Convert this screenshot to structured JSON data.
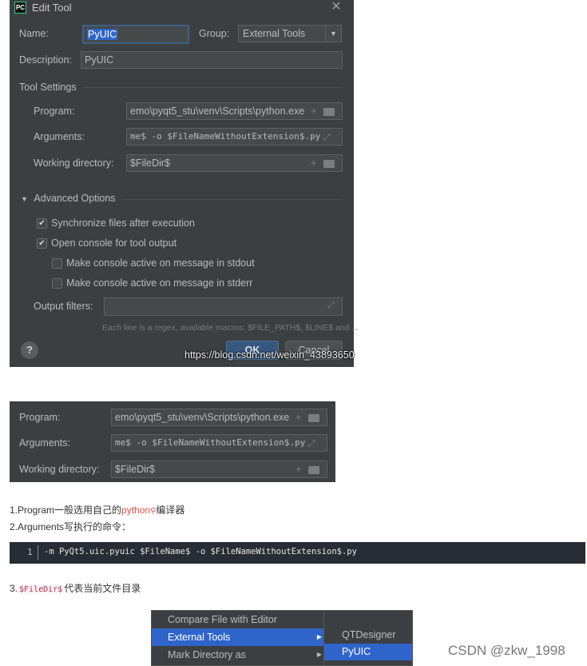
{
  "dialog": {
    "title": "Edit Tool",
    "name_label": "Name:",
    "name_value": "PyUIC",
    "group_label": "Group:",
    "group_value": "External Tools",
    "description_label": "Description:",
    "description_value": "PyUIC",
    "tool_settings": "Tool Settings",
    "program_label": "Program:",
    "program_value": "emo\\pyqt5_stu\\venv\\Scripts\\python.exe",
    "arguments_label": "Arguments:",
    "arguments_value": "me$ -o $FileNameWithoutExtension$.py",
    "workdir_label": "Working directory:",
    "workdir_value": "$FileDir$",
    "advanced_options": "Advanced Options",
    "options": [
      {
        "label": "Synchronize files after execution",
        "checked": true
      },
      {
        "label": "Open console for tool output",
        "checked": true
      },
      {
        "label": "Make console active on message in stdout",
        "checked": false
      },
      {
        "label": "Make console active on message in stderr",
        "checked": false
      }
    ],
    "output_filters_label": "Output filters:",
    "hint": "Each line is a regex, available macros: $FILE_PATH$, $LINE$ and ...",
    "help": "?",
    "ok": "OK",
    "cancel": "Cancel",
    "watermark": "https://blog.csdn.net/weixin_43893650"
  },
  "crop": {
    "program_label": "Program:",
    "program_value": "emo\\pyqt5_stu\\venv\\Scripts\\python.exe",
    "arguments_label": "Arguments:",
    "arguments_value": "me$ -o $FileNameWithoutExtension$.py",
    "workdir_label": "Working directory:",
    "workdir_value": "$FileDir$"
  },
  "article": {
    "line1_prefix": "1.Program一般选用自己的",
    "line1_link": "python",
    "line1_suffix": "编译器",
    "line2": "2.Arguments写执行的命令：",
    "code_line_number": "1",
    "code": "-m PyQt5.uic.pyuic $FileName$ -o $FileNameWithoutExtension$.py",
    "line3_prefix": "3.",
    "line3_code": "$FileDir$",
    "line3_suffix": "代表当前文件目录"
  },
  "menu": {
    "items": [
      "Compare File with Editor",
      "External Tools",
      "Mark Directory as"
    ],
    "submenu": [
      "QTDesigner",
      "PyUIC"
    ]
  },
  "footer_watermark": "CSDN @zkw_1998"
}
